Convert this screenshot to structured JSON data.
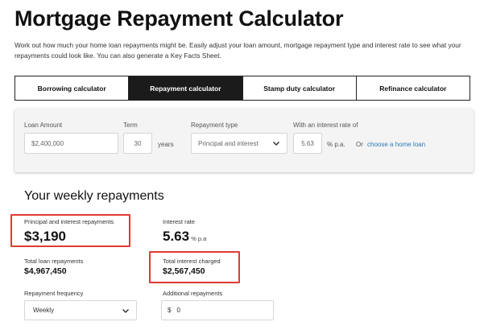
{
  "page": {
    "title": "Mortgage Repayment Calculator",
    "intro": "Work out how much your home loan repayments might be. Easily adjust your loan amount, mortgage repayment type and interest rate to see what your repayments could look like. You can also generate a Key Facts Sheet."
  },
  "tabs": [
    {
      "label": "Borrowing calculator",
      "active": false
    },
    {
      "label": "Repayment calculator",
      "active": true
    },
    {
      "label": "Stamp duty calculator",
      "active": false
    },
    {
      "label": "Refinance calculator",
      "active": false
    }
  ],
  "form": {
    "loan_amount_label": "Loan Amount",
    "loan_amount_value": "$2,400,000",
    "term_label": "Term",
    "term_value": "30",
    "term_unit": "years",
    "repayment_type_label": "Repayment type",
    "repayment_type_value": "Principal and interest",
    "interest_rate_label": "With an interest rate of",
    "interest_rate_value": "5.63",
    "interest_rate_unit": "% p.a.",
    "or_text": "Or",
    "choose_loan_link": "choose a home loan"
  },
  "results": {
    "section_title": "Your weekly repayments",
    "pi_label": "Principal and interest repayments",
    "pi_value": "$3,190",
    "rate_label": "Interest rate",
    "rate_value": "5.63",
    "rate_unit": "% p.a",
    "total_loan_label": "Total loan repayments",
    "total_loan_value": "$4,967,450",
    "total_interest_label": "Total interest charged",
    "total_interest_value": "$2,567,450",
    "frequency_label": "Repayment frequency",
    "frequency_value": "Weekly",
    "additional_label": "Additional repayments",
    "additional_currency": "$",
    "additional_value": "0"
  },
  "colors": {
    "highlight": "#e23a33",
    "link": "#2a7ab8",
    "active_tab": "#1b1b1b"
  }
}
